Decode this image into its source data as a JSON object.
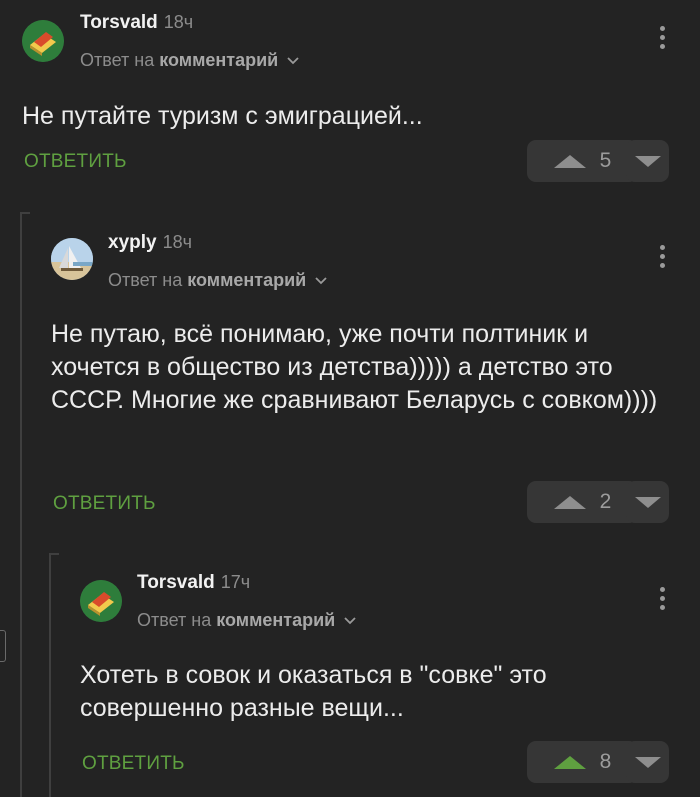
{
  "comments": [
    {
      "username": "Torsvald",
      "time": "18ч",
      "reply_prefix": "Ответ на",
      "reply_target": "комментарий",
      "text": "Не путайте туризм с эмиграцией...",
      "reply_label": "ОТВЕТИТЬ",
      "votes": "5",
      "upvoted": false
    },
    {
      "username": "xyply",
      "time": "18ч",
      "reply_prefix": "Ответ на",
      "reply_target": "комментарий",
      "text": "Не путаю, всё понимаю, уже почти полтиник и хочется в общество из детства))))) а детство это СССР. Многие же сравнивают Беларусь с совком))))",
      "reply_label": "ОТВЕТИТЬ",
      "votes": "2",
      "upvoted": false
    },
    {
      "username": "Torsvald",
      "time": "17ч",
      "reply_prefix": "Ответ на",
      "reply_target": "комментарий",
      "text": "Хотеть в совок и оказаться в \"совке\" это совершенно разные вещи...",
      "reply_label": "ОТВЕТИТЬ",
      "votes": "8",
      "upvoted": true
    }
  ],
  "colors": {
    "background": "#232323",
    "accent_green": "#5fa040",
    "muted": "#8c8c8c"
  },
  "icons": [
    "avatar-torsvald",
    "avatar-xyply",
    "chevron-down-icon",
    "more-vertical-icon",
    "upvote-icon",
    "downvote-icon"
  ]
}
